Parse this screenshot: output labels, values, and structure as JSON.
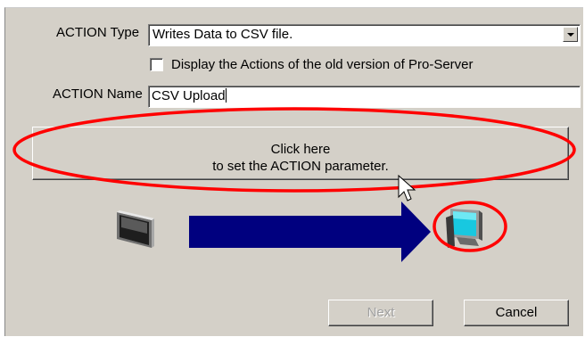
{
  "action_type": {
    "label": "ACTION Type",
    "selected": "Writes Data to CSV file."
  },
  "old_version_checkbox": {
    "label": "Display the Actions of the old version of Pro-Server",
    "checked": false
  },
  "action_name": {
    "label": "ACTION Name",
    "value": "CSV Upload"
  },
  "set_parameter_button": {
    "line1": "Click here",
    "line2": "to set the ACTION parameter."
  },
  "footer": {
    "next_label": "Next",
    "next_enabled": false,
    "cancel_label": "Cancel"
  },
  "icons": {
    "source": "display-terminal-icon",
    "flow": "right-arrow-icon",
    "destination": "pc-monitor-icon",
    "cursor": "mouse-pointer-icon"
  },
  "colors": {
    "panel": "#d4d0c8",
    "arrow": "#00007f",
    "highlight": "#ff0000"
  }
}
